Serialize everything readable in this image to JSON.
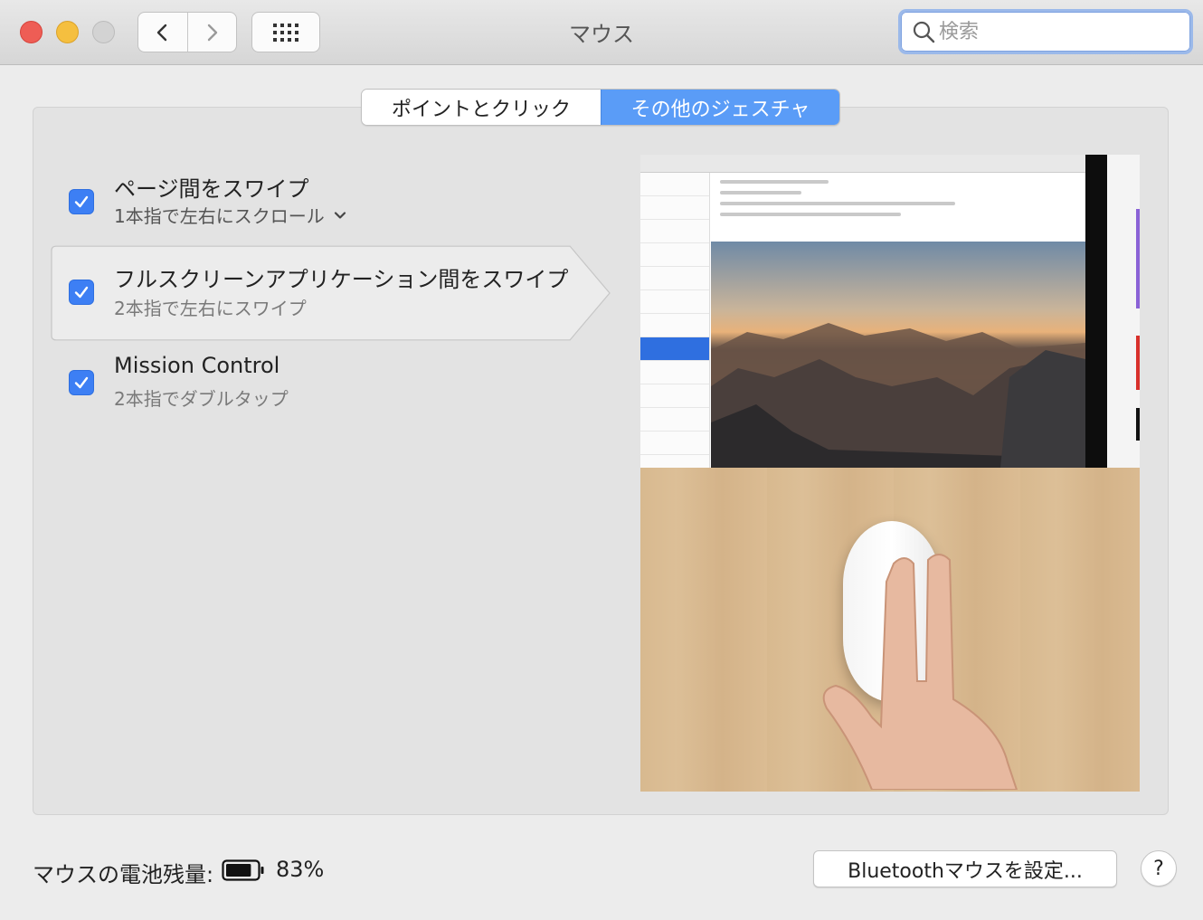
{
  "window": {
    "title": "マウス"
  },
  "search": {
    "placeholder": "検索"
  },
  "tabs": [
    {
      "label": "ポイントとクリック",
      "selected": false
    },
    {
      "label": "その他のジェスチャ",
      "selected": true
    }
  ],
  "options": [
    {
      "title": "ページ間をスワイプ",
      "subtitle": "1本指で左右にスクロール",
      "checked": true,
      "has_dropdown": true
    },
    {
      "title": "フルスクリーンアプリケーション間をスワイプ",
      "subtitle": "2本指で左右にスワイプ",
      "checked": true,
      "selected": true
    },
    {
      "title": "Mission Control",
      "subtitle": "2本指でダブルタップ",
      "checked": true
    }
  ],
  "battery": {
    "label": "マウスの電池残量:",
    "percent_text": "83%",
    "level": 0.83
  },
  "buttons": {
    "bluetooth": "Bluetoothマウスを設定...",
    "help": "?"
  },
  "colors": {
    "accent": "#3d7ff4",
    "tab_selected": "#5a9cf7",
    "close": "#ee5d55",
    "minimize": "#f5bf3f"
  }
}
